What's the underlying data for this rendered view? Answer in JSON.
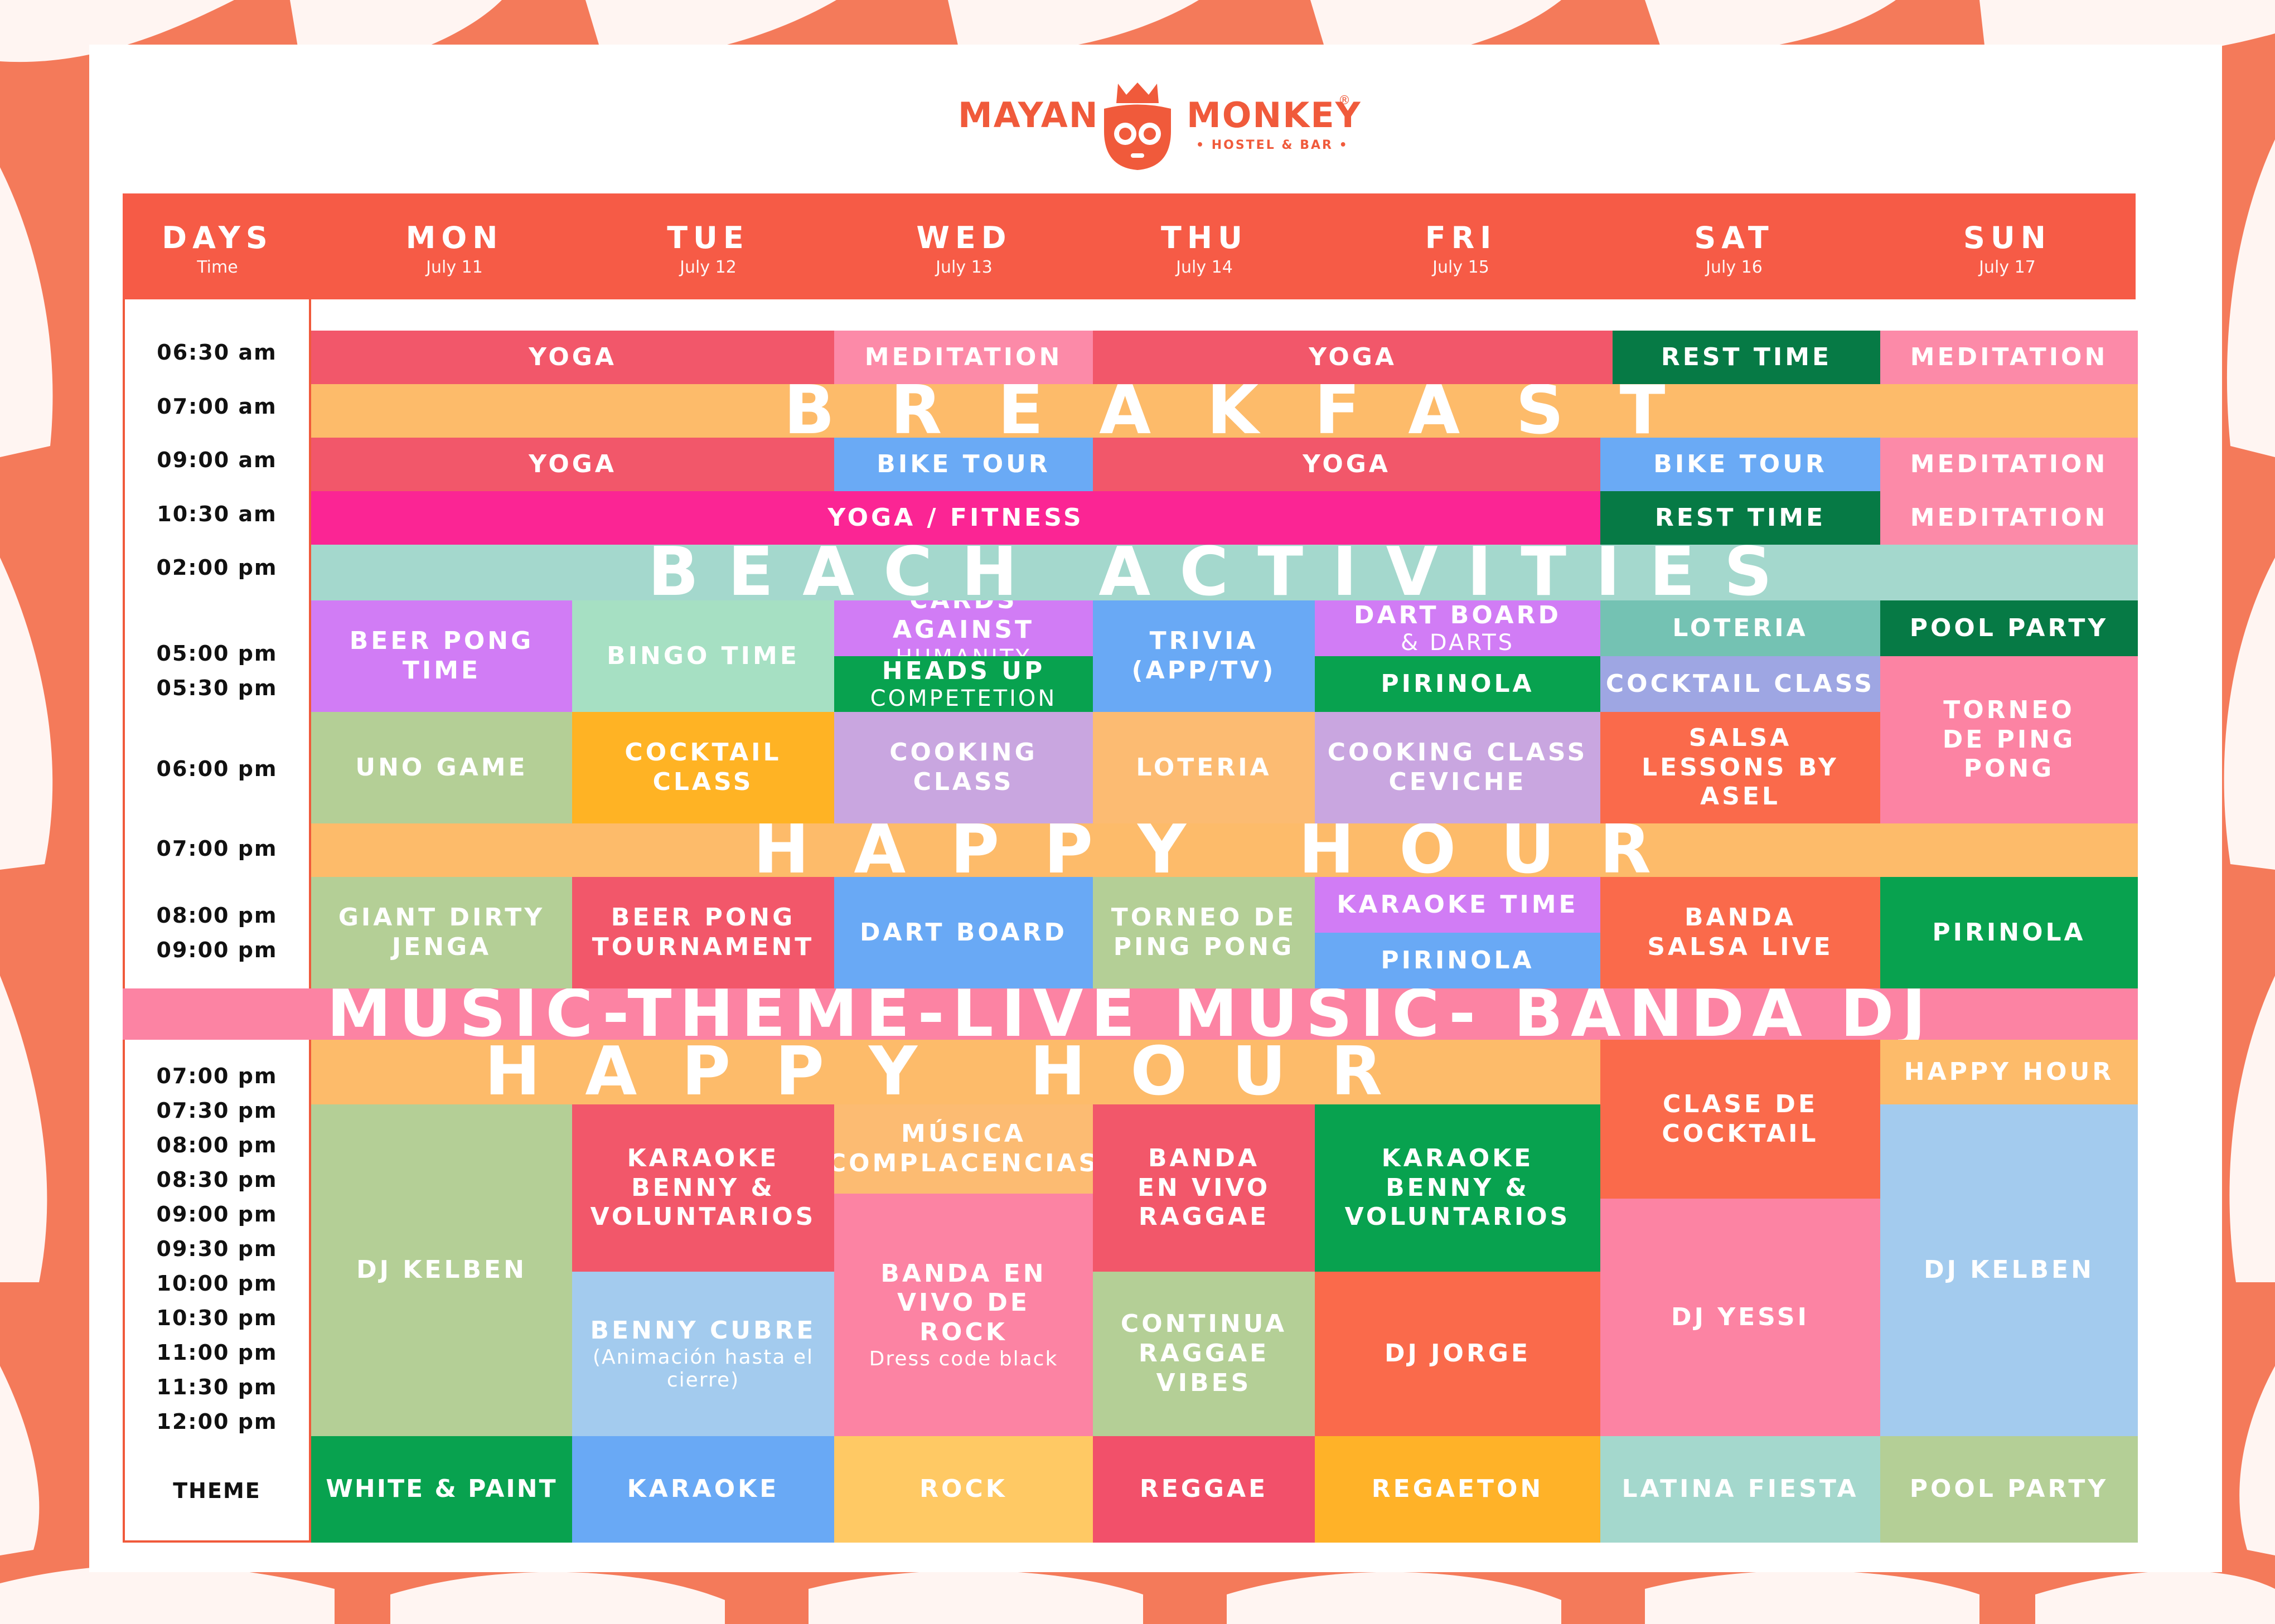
{
  "brand": {
    "name_left": "MAYAN",
    "name_right": "MONKEY",
    "registered": "®",
    "tagline": "• HOSTEL & BAR •",
    "color": "#f05a3b"
  },
  "header": {
    "days_label": "DAYS",
    "days_sub": "Time",
    "days": [
      {
        "name": "MON",
        "date": "July 11"
      },
      {
        "name": "TUE",
        "date": "July 12"
      },
      {
        "name": "WED",
        "date": "July 13"
      },
      {
        "name": "THU",
        "date": "July 14"
      },
      {
        "name": "FRI",
        "date": "July 15"
      },
      {
        "name": "SAT",
        "date": "July 16"
      },
      {
        "name": "SUN",
        "date": "July 17"
      }
    ]
  },
  "times": {
    "t1": "06:30 am",
    "t2": "07:00 am",
    "t3": "09:00 am",
    "t4": "10:30 am",
    "t5": "02:00 pm",
    "t6": "05:00 pm",
    "t7": "05:30 pm",
    "t8": "06:00 pm",
    "t9": "07:00 pm",
    "t10": "08:00 pm",
    "t11": "09:00 pm",
    "n1": "07:00 pm",
    "n2": "07:30 pm",
    "n3": "08:00 pm",
    "n4": "08:30 pm",
    "n5": "09:00 pm",
    "n6": "09:30 pm",
    "n7": "10:00 pm",
    "n8": "10:30 pm",
    "n9": "11:00 pm",
    "n10": "11:30 pm",
    "n11": "12:00 pm",
    "theme": "THEME"
  },
  "activities": {
    "yoga": "YOGA",
    "meditation": "MEDITATION",
    "rest_time": "REST TIME",
    "breakfast": "BREAKFAST",
    "bike_tour": "BIKE TOUR",
    "yoga_fitness": "YOGA / FITNESS",
    "beach": "BEACH ACTIVITIES",
    "beer_pong_time": "BEER PONG TIME",
    "bingo": "BINGO TIME",
    "cards_a": "CARDS AGAINST",
    "cards_b": "HUMANITY",
    "heads_a": "HEADS UP",
    "heads_b": "COMPETETION",
    "trivia_a": "TRIVIA",
    "trivia_b": "(APP/TV)",
    "dart_a": "DART BOARD",
    "dart_b": "& DARTS",
    "pirinola": "PIRINOLA",
    "loteria": "LOTERIA",
    "cocktail_class_wide": "COCKTAIL CLASS",
    "pool_party": "POOL PARTY",
    "torneo_sun": "TORNEO DE PING PONG",
    "uno": "UNO GAME",
    "cocktail_class": "COCKTAIL CLASS",
    "cooking_class": "COOKING CLASS",
    "cooking_ceviche_a": "COOKING CLASS",
    "cooking_ceviche_b": "CEVICHE",
    "salsa": "SALSA LESSONS BY ASEL",
    "happy_hour": "HAPPY HOUR",
    "jenga": "GIANT DIRTY JENGA",
    "beer_pong_tournament": "BEER PONG TOURNAMENT",
    "dart_board": "DART BOARD",
    "torneo_thu": "TORNEO DE PING PONG",
    "karaoke_time": "KARAOKE TIME",
    "banda_salsa": "BANDA SALSA LIVE",
    "music_banner": "MUSIC-THEME-LIVE MUSIC- BANDA DJ",
    "clase_cocktail": "CLASE DE COCKTAIL",
    "happy_hour_small": "HAPPY HOUR",
    "dj_kelben": "DJ KELBEN",
    "karaoke_benny": "KARAOKE BENNY & VOLUNTARIOS",
    "musica": "MÚSICA COMPLACENCIAS",
    "banda_raggae": "BANDA EN VIVO RAGGAE",
    "banda_rock_a": "BANDA EN VIVO DE ROCK",
    "banda_rock_b": "Dress code black",
    "benny_cubre_a": "BENNY CUBRE",
    "benny_cubre_b": "(Animación hasta el cierre)",
    "continua": "CONTINUA RAGGAE VIBES",
    "dj_jorge": "DJ JORGE",
    "dj_yessi": "DJ YESSI"
  },
  "themes": [
    "WHITE & PAINT",
    "KARAOKE",
    "ROCK",
    "REGGAE",
    "REGAETON",
    "LATINA FIESTA",
    "POOL PARTY"
  ],
  "colors": {
    "header": "#f65b46",
    "pink_red": "#f2576a",
    "light_pink": "#fc8aa8",
    "dark_green": "#067a45",
    "orange_band": "#fdbb6a",
    "blue": "#6aaaf5",
    "magenta": "#fb2594",
    "teal": "#a4d8cd",
    "lavender": "#d17cf5",
    "mint": "#a6e0c3",
    "green": "#08a24f",
    "light_blue": "#69a9f5",
    "periwinkle": "#9ea6e3",
    "sage": "#b4cf96",
    "amber": "#ffb324",
    "light_purple": "#c9a6e0",
    "peach": "#fcbb72",
    "coral": "#fa6a4b",
    "sky": "#a3cbee",
    "rose": "#fc83a3",
    "yellow": "#ffc964",
    "theme_red": "#f2506a",
    "theme_gold": "#ffb228"
  }
}
